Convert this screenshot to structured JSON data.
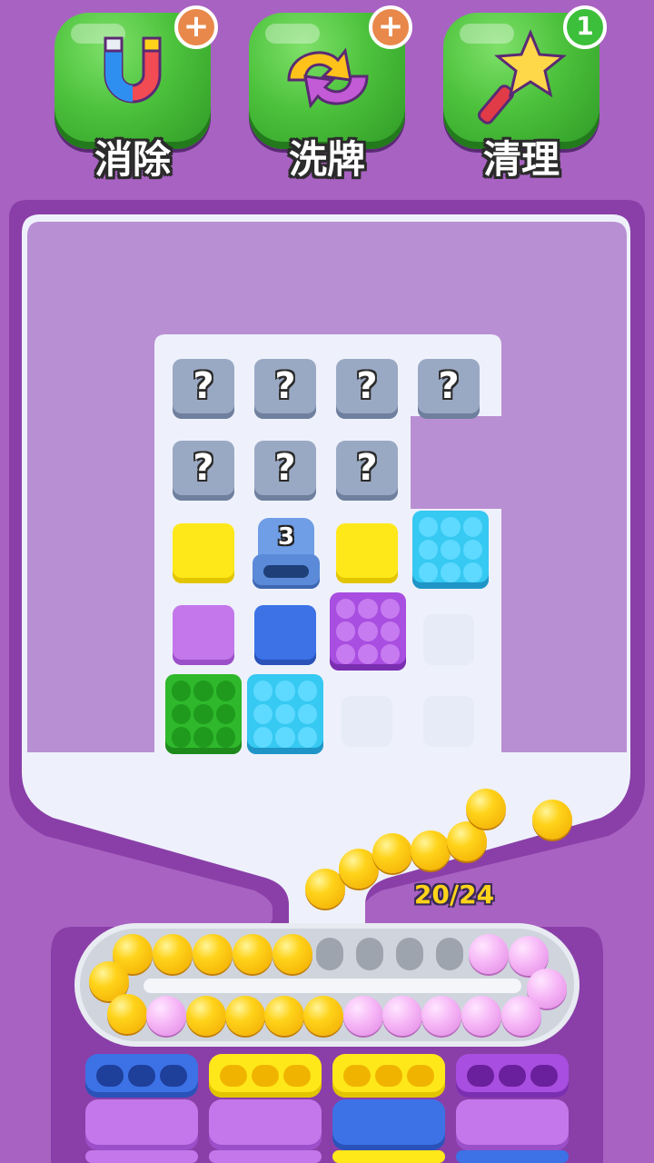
{
  "boosters": [
    {
      "label": "消除",
      "badge": "+",
      "icon": "magnet-icon"
    },
    {
      "label": "洗牌",
      "badge": "+",
      "icon": "shuffle-icon"
    },
    {
      "label": "清理",
      "badge": "1",
      "icon": "magic-wand-icon"
    }
  ],
  "board": {
    "mystery_mark": "?",
    "tunnel_count": "3"
  },
  "progress": {
    "text": "20/24",
    "collected": 20,
    "total": 24
  },
  "colors": {
    "background": "#a862c2",
    "yellow": "#ffe81a",
    "purple": "#c377ea",
    "blue": "#3c72e6",
    "cyan": "#36c9f2",
    "green": "#2fb82c",
    "pink": "#f6b6f6"
  }
}
